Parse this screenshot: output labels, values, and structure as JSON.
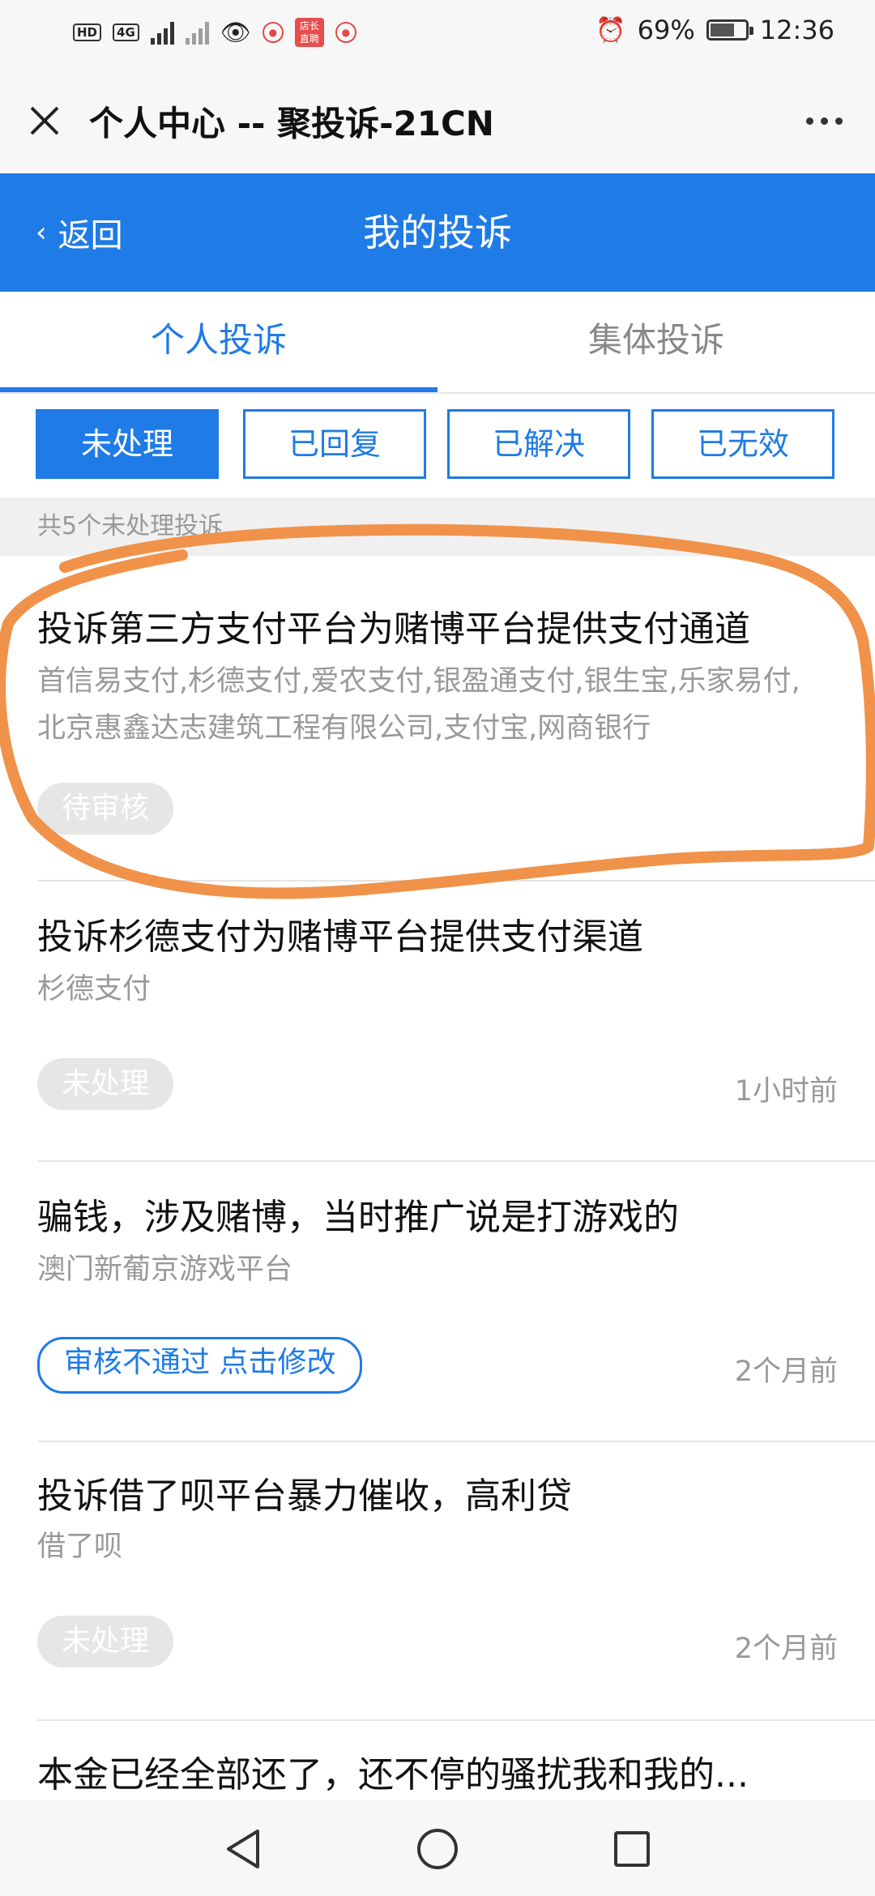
{
  "status_bar": {
    "left_badges": [
      "HD",
      "4G"
    ],
    "shop_badge": "店长\n直聘",
    "battery": "69%",
    "battery_level": 0.69,
    "time": "12:36"
  },
  "titlebar": {
    "title": "个人中心 -- 聚投诉-21CN",
    "close_icon": "close-icon",
    "more_icon": "more-icon"
  },
  "navbar": {
    "back_label": "返回",
    "title": "我的投诉",
    "color": "#1f7be6"
  },
  "tabs": [
    {
      "label": "个人投诉",
      "active": true
    },
    {
      "label": "集体投诉",
      "active": false
    }
  ],
  "filters": [
    {
      "label": "未处理",
      "active": true
    },
    {
      "label": "已回复",
      "active": false
    },
    {
      "label": "已解决",
      "active": false
    },
    {
      "label": "已无效",
      "active": false
    }
  ],
  "count_text": "共5个未处理投诉",
  "complaints": [
    {
      "title": "投诉第三方支付平台为赌博平台提供支付通道",
      "companies": "首信易支付,杉德支付,爱农支付,银盈通支付,银生宝,乐家易付,北京惠鑫达志建筑工程有限公司,支付宝,网商银行",
      "status": "待审核",
      "time": ""
    },
    {
      "title": "投诉杉德支付为赌博平台提供支付渠道",
      "companies": "杉德支付",
      "status": "未处理",
      "time": "1小时前"
    },
    {
      "title": "骗钱，涉及赌博，当时推广说是打游戏的",
      "companies": "澳门新葡京游戏平台",
      "status": "审核不通过 点击修改",
      "time": "2个月前"
    },
    {
      "title": "投诉借了呗平台暴力催收，高利贷",
      "companies": "借了呗",
      "status": "未处理",
      "time": "2个月前"
    },
    {
      "title": "本金已经全部还了，还不停的骚扰我和我的...",
      "companies": "",
      "status": "",
      "time": ""
    }
  ],
  "annotation_color": "#f0924a",
  "system_nav": [
    "back-icon",
    "home-icon",
    "recents-icon"
  ]
}
